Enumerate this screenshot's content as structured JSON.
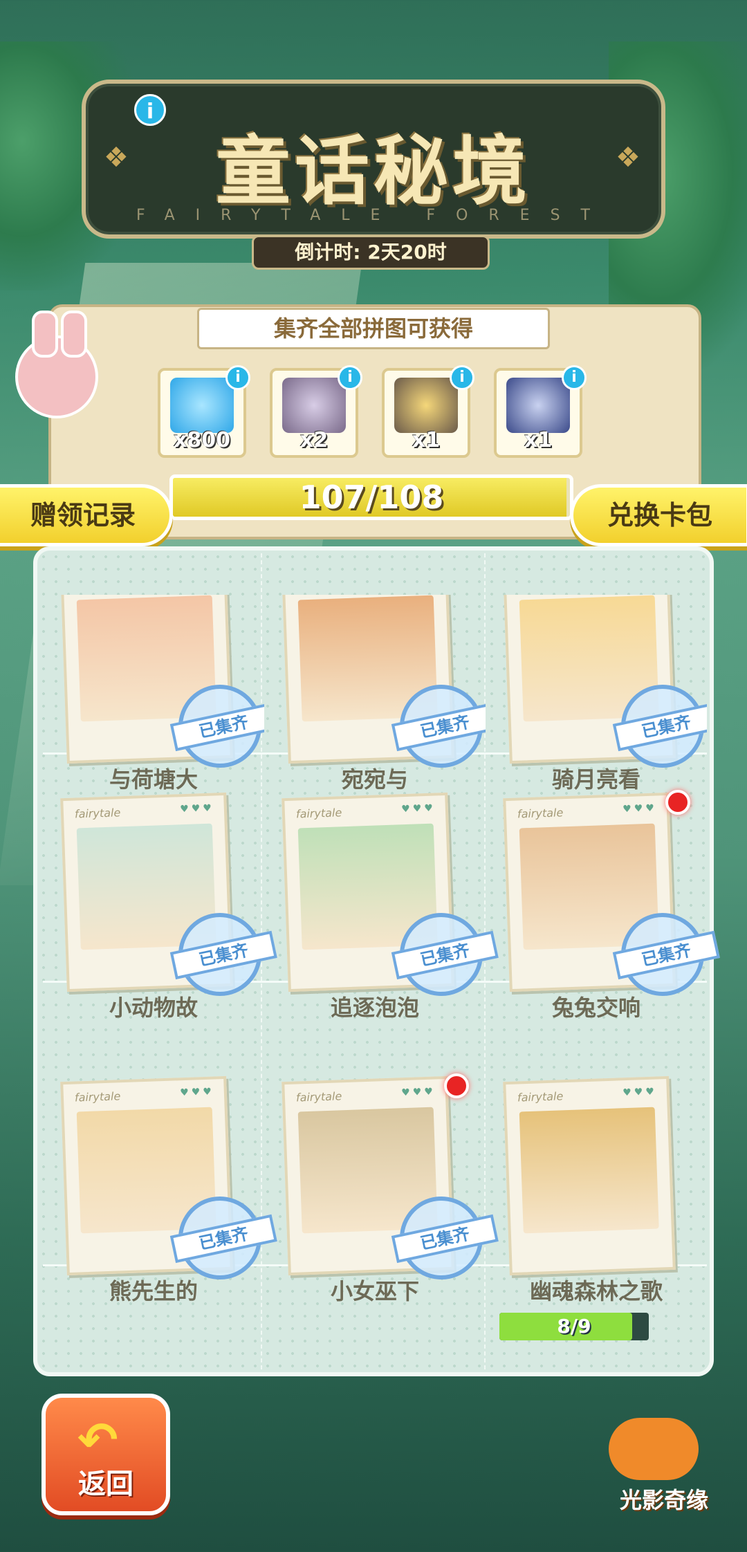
{
  "title": {
    "main": "童话秘境",
    "sub": "FAIRYTALE FOREST",
    "countdown": "倒计时: 2天20时"
  },
  "reward": {
    "header": "集齐全部拼图可获得",
    "items": [
      {
        "icon": "diamond-icon",
        "count": "x800",
        "color": "#2fa7e8"
      },
      {
        "icon": "lucky-cat-icon",
        "count": "x2",
        "color": "#7a6a8a"
      },
      {
        "icon": "star-card-icon",
        "count": "x1",
        "color": "#6a5a4a"
      },
      {
        "icon": "witch-avatar-icon",
        "count": "x1",
        "color": "#3b4a8a"
      }
    ],
    "progress": {
      "text": "107/108",
      "value": 0.9907
    }
  },
  "buttons": {
    "record": "赠领记录",
    "exchange": "兑换卡包",
    "back": "返回"
  },
  "stamp_label": "已集齐",
  "card_brand": "fairytale",
  "cards": [
    {
      "name": "与荷塘大",
      "collected": true,
      "red_dot": false,
      "art_color": "#f4c6a6"
    },
    {
      "name": "宛宛与",
      "collected": true,
      "red_dot": false,
      "art_color": "#e9b07e"
    },
    {
      "name": "骑月亮看",
      "collected": true,
      "red_dot": false,
      "art_color": "#f7d995"
    },
    {
      "name": "小动物故",
      "collected": true,
      "red_dot": false,
      "art_color": "#cfe6d9"
    },
    {
      "name": "追逐泡泡",
      "collected": true,
      "red_dot": false,
      "art_color": "#bfe0b8"
    },
    {
      "name": "兔兔交响",
      "collected": true,
      "red_dot": true,
      "art_color": "#e9c49a"
    },
    {
      "name": "熊先生的",
      "collected": true,
      "red_dot": false,
      "art_color": "#f2d9a8"
    },
    {
      "name": "小女巫下",
      "collected": true,
      "red_dot": true,
      "art_color": "#d9c7a0"
    },
    {
      "name": "幽魂森林之歌",
      "collected": false,
      "red_dot": false,
      "art_color": "#e6c27a",
      "progress": {
        "text": "8/9",
        "value": 0.889
      }
    }
  ],
  "logo": {
    "text": "光影奇缘",
    "icon": "mascot-logo-icon"
  },
  "colors": {
    "accent": "#f2d02d",
    "stamp": "#6fa8e0",
    "red_dot": "#e82424"
  }
}
